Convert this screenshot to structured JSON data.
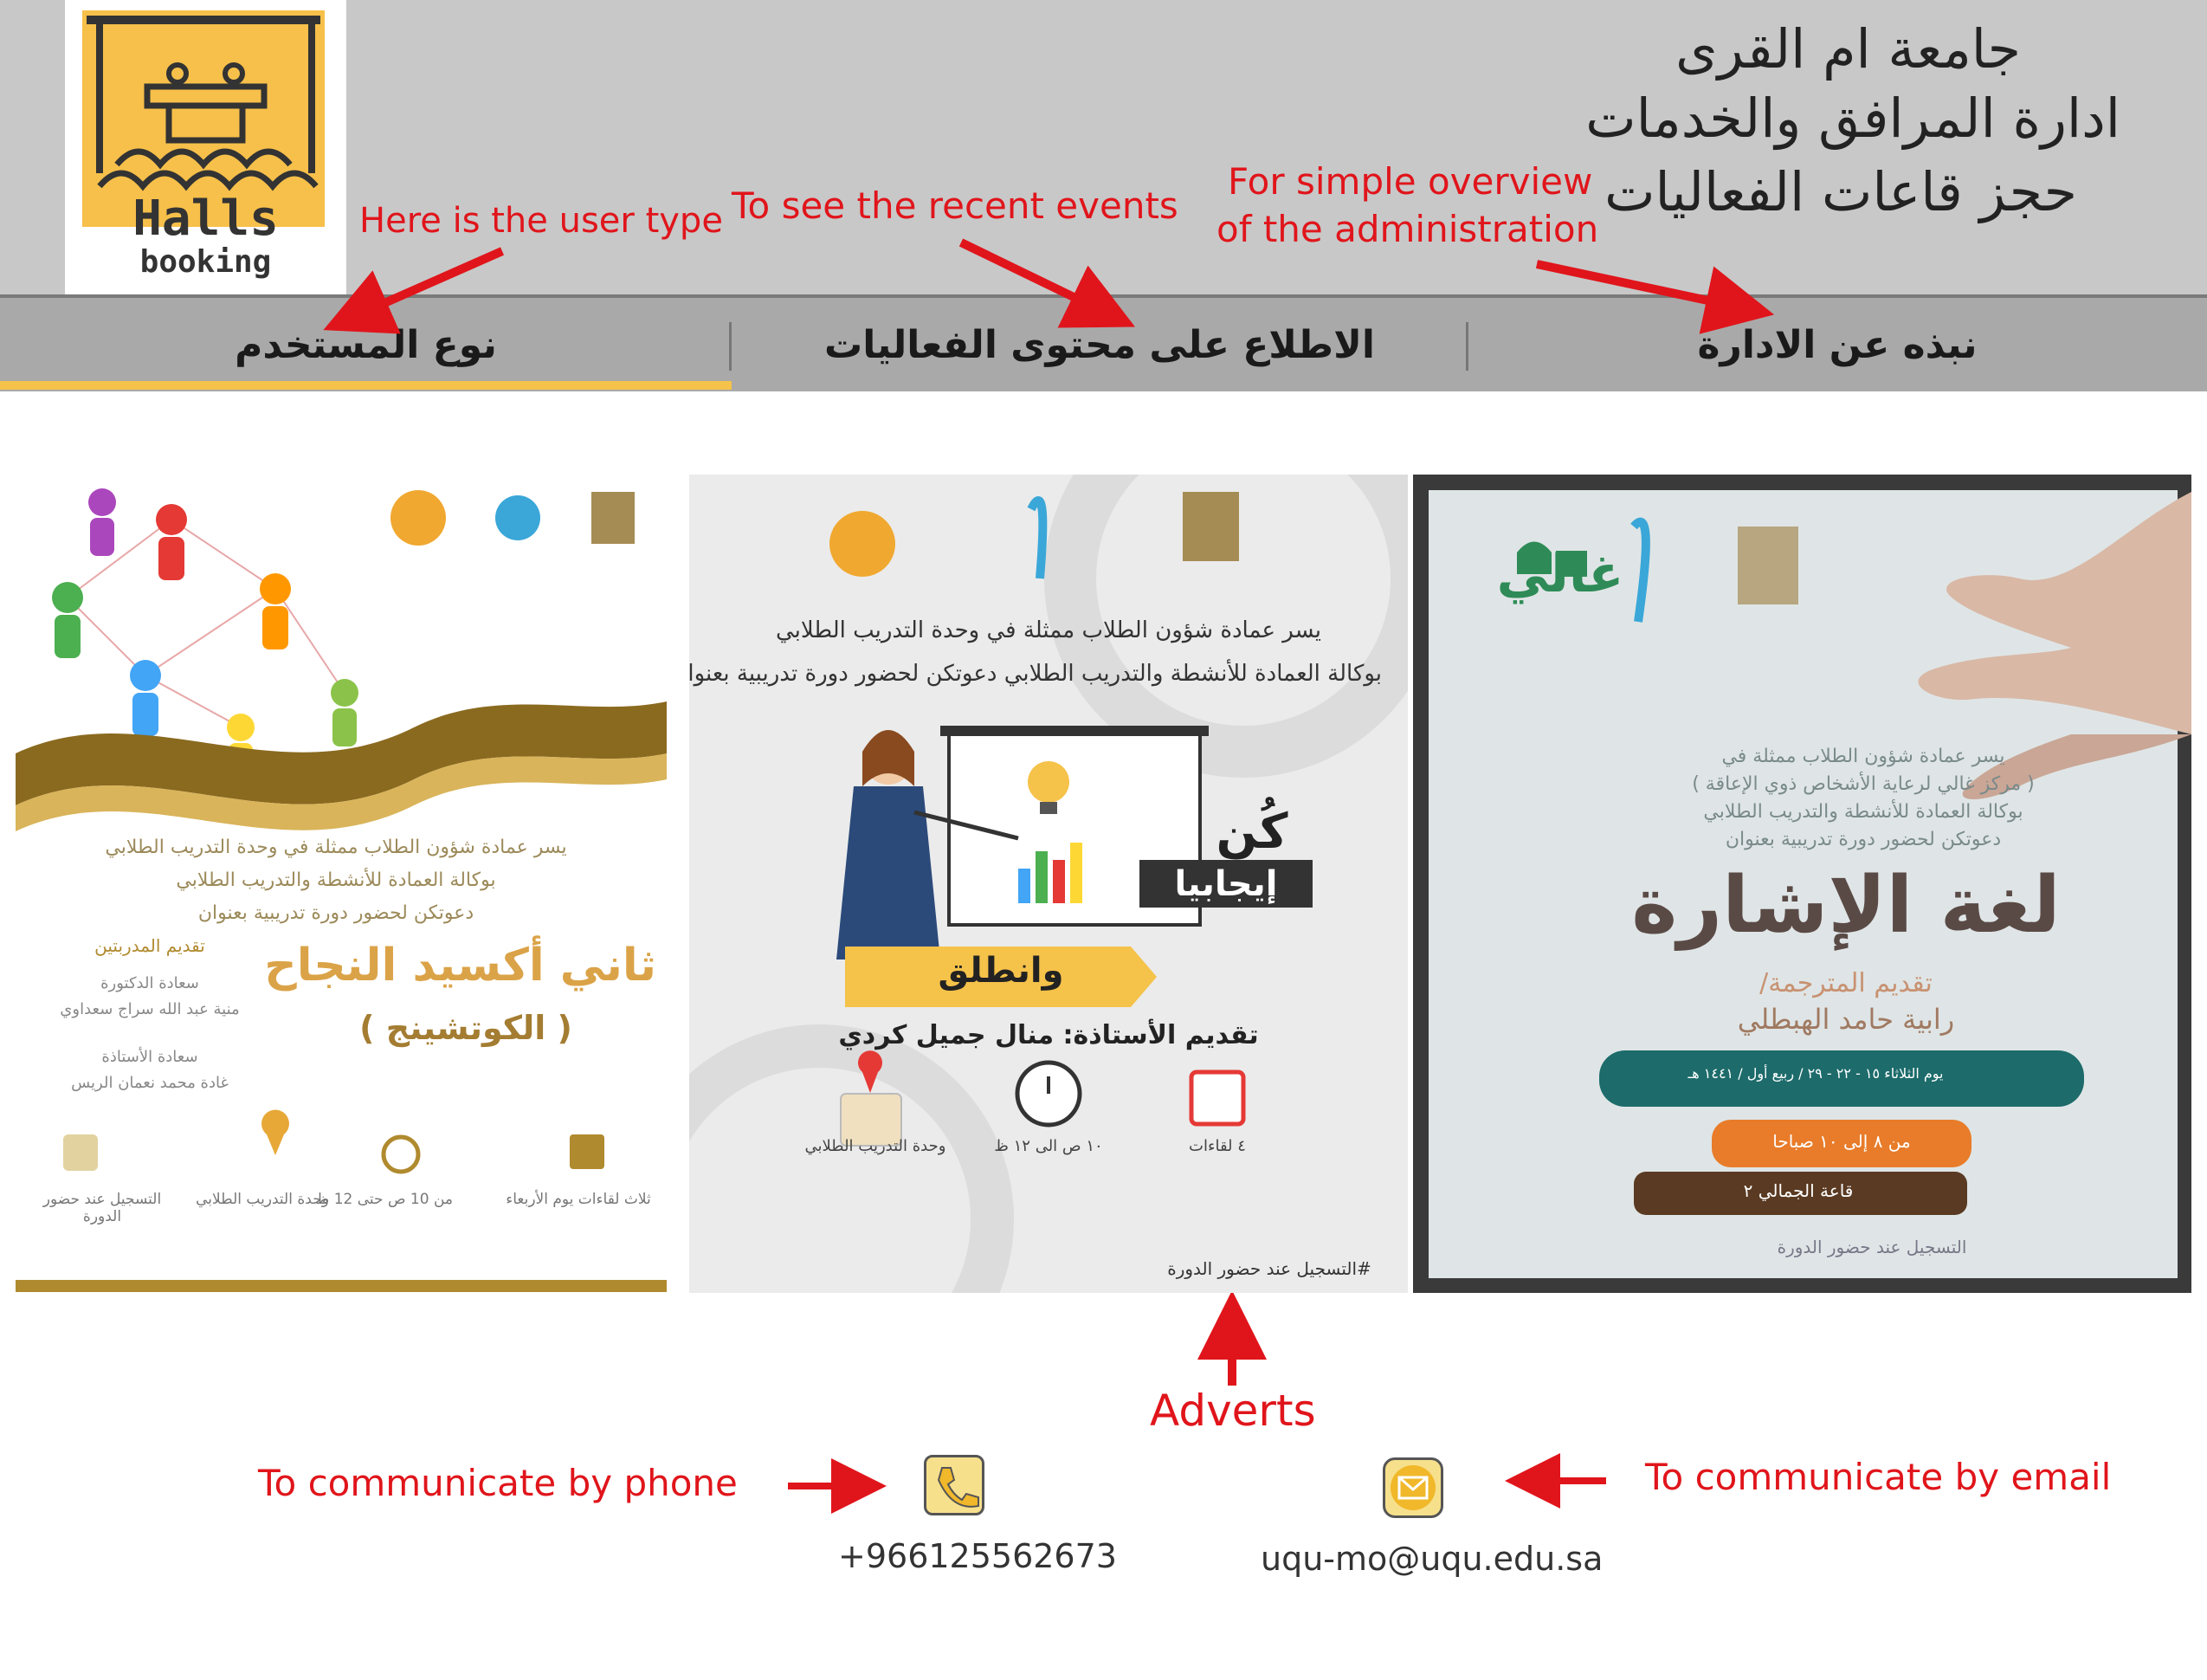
{
  "header": {
    "logo": {
      "line1": "Halls",
      "line2": "booking"
    },
    "title_lines": [
      "جامعة ام القرى",
      "ادارة المرافق والخدمات",
      "حجز قاعات الفعاليات"
    ]
  },
  "nav": {
    "tabs": [
      {
        "label": "نوع المستخدم",
        "active": true
      },
      {
        "label": "الاطلاع على محتوى الفعاليات",
        "active": false
      },
      {
        "label": "نبذه عن الادارة",
        "active": false
      }
    ],
    "active_color": "#f5c24a"
  },
  "annotations": {
    "user_type": "Here is the user type",
    "recent_events": "To see the recent events",
    "overview_line1": "For simple overview",
    "overview_line2": "of the administration",
    "adverts": "Adverts",
    "phone": "To communicate by phone",
    "email": "To communicate by email"
  },
  "adverts": [
    {
      "intro_lines": [
        "يسر عمادة شؤون الطلاب ممثلة في وحدة التدريب الطلابي",
        "بوكالة العمادة للأنشطة والتدريب الطلابي",
        "دعوتكن لحضور دورة تدريبية بعنوان"
      ],
      "title": "ثاني أكسيد النجاح",
      "subtitle": "( الكوتشينج )",
      "presenters_heading": "تقديم المدربتين",
      "presenter1_role": "سعادة الدكتورة",
      "presenter1_name": "منية عبد الله سراج سعداوي",
      "presenter2_role": "سعادة الأستاذة",
      "presenter2_name": "غادة محمد نعمان الريس",
      "info": [
        "ثلاث لقاءات يوم الأربعاء",
        "من 10 ص حتى 12 ظ",
        "وحدة التدريب الطلابي",
        "التسجيل عند حضور الدورة"
      ]
    },
    {
      "intro_line1": "يسر عمادة شؤون الطلاب ممثلة في وحدة التدريب الطلابي",
      "intro_line2": "بوكالة العمادة للأنشطة والتدريب الطلابي دعوتكن لحضور دورة تدريبية بعنوان",
      "slogan_be": "كُن",
      "slogan_positive": "إيجابيا",
      "slogan_go": "وانطلق",
      "presenter": "تقديم الأستاذة: منال جميل كردي",
      "info": [
        "٤ لقاءات",
        "١٠ ص الى ١٢ ظ",
        "وحدة التدريب الطلابي"
      ],
      "registration": "#التسجيل عند حضور الدورة"
    },
    {
      "intro_lines": [
        "يسر عمادة شؤون الطلاب ممثلة في",
        "( مركز غالي لرعاية الأشخاص ذوي الإعاقة )",
        "بوكالة العمادة للأنشطة والتدريب الطلابي",
        "دعوتكن لحضور دورة تدريبية بعنوان"
      ],
      "title": "لغة الإشارة",
      "presenter_label": "تقديم المترجمة/",
      "presenter_name": "رابية حامد الهبطلي",
      "pill_date": "يوم الثلاثاء ١٥ - ٢٢ - ٢٩ / ربيع أول / ١٤٤١ هـ",
      "pill_time": "من ٨ إلى ١٠ صباحا",
      "pill_place": "قاعة الجمالي ٢",
      "registration": "التسجيل عند حضور الدورة",
      "brand": "غالي"
    }
  ],
  "contact": {
    "phone": "+966125562673",
    "email": "uqu-mo@uqu.edu.sa"
  }
}
